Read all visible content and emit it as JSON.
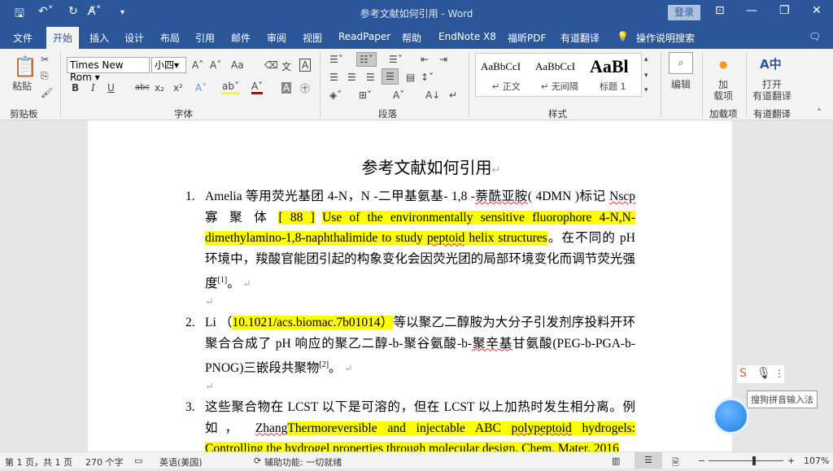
{
  "window": {
    "title": "参考文献如何引用 - Word",
    "login": "登录"
  },
  "quick_access": [
    "save-icon",
    "undo-icon",
    "redo-icon",
    "spelling-icon",
    "customize-icon"
  ],
  "tabs": [
    "文件",
    "开始",
    "插入",
    "设计",
    "布局",
    "引用",
    "邮件",
    "审阅",
    "视图",
    "ReadPaper",
    "帮助",
    "EndNote X8",
    "福昕PDF",
    "有道翻译"
  ],
  "active_tab": "开始",
  "tell_me": "操作说明搜索",
  "ribbon": {
    "clipboard": {
      "paste": "粘贴",
      "group": "剪贴板"
    },
    "font": {
      "name": "Times New Rom",
      "size": "小四",
      "group": "字体",
      "bold": "B",
      "italic": "I",
      "underline": "U",
      "strike": "abc",
      "sub": "x₂",
      "sup": "x²",
      "grow": "A˄",
      "shrink": "A˅",
      "case": "Aa",
      "color_highlight": "#ffff00",
      "color_font": "#c00000"
    },
    "paragraph": {
      "group": "段落"
    },
    "styles": {
      "group": "样式",
      "items": [
        {
          "preview": "AaBbCcI",
          "label": "↵ 正文"
        },
        {
          "preview": "AaBbCcI",
          "label": "↵ 无间隔"
        },
        {
          "preview": "AaBl",
          "label": "标题 1"
        }
      ]
    },
    "editing": {
      "label": "编辑"
    },
    "addins": {
      "label": "加\n载项",
      "group": "加载项"
    },
    "youdao": {
      "label": "打开\n有道翻译",
      "group": "有道翻译"
    }
  },
  "document": {
    "title": "参考文献如何引用",
    "items": [
      {
        "num": "1.",
        "segments": [
          {
            "t": "Amelia 等用荧光基团 4-N，N -二甲基氨基- 1,8 -"
          },
          {
            "t": "萘酰亚胺",
            "sq": true
          },
          {
            "t": "( 4DMN )标记 "
          },
          {
            "t": "Nscp",
            "sq": true
          },
          {
            "t": " 寡 聚 体 "
          },
          {
            "t": "[ 88 ]",
            "hl": true
          },
          {
            "t": " "
          },
          {
            "t": "Use of the environmentally sensitive fluorophore 4-N,N-dimethylamino-1,8-naphthalimide to study ",
            "hl": true
          },
          {
            "t": "peptoid",
            "hl": true,
            "sq": true
          },
          {
            "t": " helix structures",
            "hl": true
          },
          {
            "t": "。在不同的 pH 环境中，羧酸官能团引起的构象变化会因荧光团的局部环境变化而调节荧光强度"
          },
          {
            "t": "[1]",
            "sup": true
          },
          {
            "t": "。"
          }
        ]
      },
      {
        "num": "2.",
        "segments": [
          {
            "t": "Li （"
          },
          {
            "t": "10.1021/acs.biomac.7b01014）",
            "hl": true
          },
          {
            "t": "等以聚乙二醇胺为大分子引发剂序投料开环聚合合成了 pH 响应的聚乙二醇-b-聚谷氨酸-b-"
          },
          {
            "t": "聚辛基",
            "sq": true
          },
          {
            "t": "甘氨酸(PEG-b-PGA-b-PNOG)三嵌段共聚物"
          },
          {
            "t": "[2]",
            "sup": true
          },
          {
            "t": "。"
          }
        ]
      },
      {
        "num": "3.",
        "segments": [
          {
            "t": "这些聚合物在 LCST 以下是可溶的，但在 LCST 以上加热时发生相分离。例如， "
          },
          {
            "t": "Zhang",
            "sq": true
          },
          {
            "t": "Thermoreversible and injectable ABC ",
            "hl": true
          },
          {
            "t": "polypeptoid",
            "hl": true,
            "sq": true
          },
          {
            "t": " hydrogels: Controlling the hydrogel properties through molecular design. Chem. Mater. 2016",
            "hl": true
          }
        ]
      }
    ]
  },
  "status": {
    "page": "第 1 页，共 1 页",
    "words": "270 个字",
    "language": "英语(美国)",
    "accessibility": "辅助功能: 一切就绪",
    "zoom": "107%",
    "zoom_level": 107
  },
  "ime": {
    "tooltip": "搜狗拼音输入法"
  }
}
